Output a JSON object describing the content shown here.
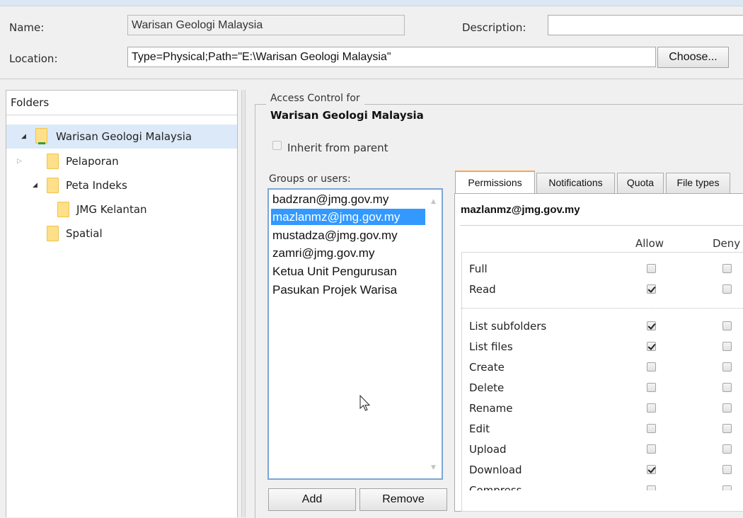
{
  "header": {
    "name_label": "Name:",
    "name_value": "Warisan Geologi Malaysia",
    "description_label": "Description:",
    "description_value": "",
    "location_label": "Location:",
    "location_value": "Type=Physical;Path=\"E:\\Warisan Geologi Malaysia\"",
    "choose_label": "Choose..."
  },
  "folders": {
    "title": "Folders",
    "items": [
      {
        "label": "Warisan Geologi Malaysia",
        "expanded": true,
        "selected": true
      },
      {
        "label": "Pelaporan",
        "expanded": false
      },
      {
        "label": "Peta Indeks",
        "expanded": true
      },
      {
        "label": "JMG Kelantan"
      },
      {
        "label": "Spatial"
      }
    ]
  },
  "access": {
    "legend": "Access Control for",
    "target": "Warisan Geologi Malaysia",
    "inherit_label": "Inherit from parent",
    "inherit_checked": false,
    "groups_label": "Groups or users:",
    "users": [
      "badzran@jmg.gov.my",
      "mazlanmz@jmg.gov.my",
      "mustadza@jmg.gov.my",
      "zamri@jmg.gov.my",
      "Ketua Unit Pengurusan",
      "Pasukan Projek Warisa"
    ],
    "selected_user_index": 1,
    "add_label": "Add",
    "remove_label": "Remove"
  },
  "tabs": {
    "items": [
      "Permissions",
      "Notifications",
      "Quota",
      "File types"
    ],
    "active": "Permissions"
  },
  "permissions": {
    "user": "mazlanmz@jmg.gov.my",
    "allow_header": "Allow",
    "deny_header": "Deny",
    "rows": [
      {
        "label": "Full",
        "allow": false,
        "deny": false
      },
      {
        "label": "Read",
        "allow": true,
        "deny": false
      },
      {
        "label": "List subfolders",
        "allow": true,
        "deny": false
      },
      {
        "label": "List files",
        "allow": true,
        "deny": false
      },
      {
        "label": "Create",
        "allow": false,
        "deny": false
      },
      {
        "label": "Delete",
        "allow": false,
        "deny": false
      },
      {
        "label": "Rename",
        "allow": false,
        "deny": false
      },
      {
        "label": "Edit",
        "allow": false,
        "deny": false
      },
      {
        "label": "Upload",
        "allow": false,
        "deny": false
      },
      {
        "label": "Download",
        "allow": true,
        "deny": false
      },
      {
        "label": "Compress",
        "allow": false,
        "deny": false
      }
    ]
  }
}
